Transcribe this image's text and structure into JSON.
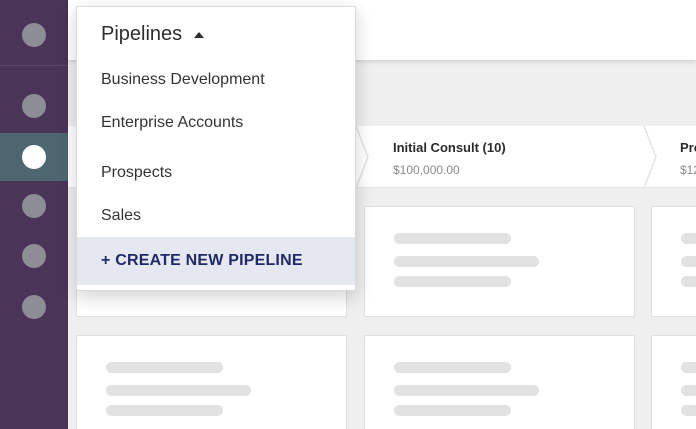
{
  "sidebar": {
    "items": [
      {
        "icon": "nav-dot-icon"
      },
      {
        "icon": "nav-dot-icon"
      },
      {
        "icon": "nav-dot-icon",
        "active": true
      },
      {
        "icon": "nav-dot-icon"
      },
      {
        "icon": "nav-dot-icon"
      },
      {
        "icon": "nav-dot-icon"
      }
    ]
  },
  "pipeline_menu": {
    "title": "Pipelines",
    "items": [
      "Business Development",
      "Enterprise Accounts",
      "Prospects",
      "Sales"
    ],
    "create_label": "+ CREATE NEW PIPELINE"
  },
  "stages": [
    {
      "name": "Initial Consult (10)",
      "amount": "$100,000.00"
    },
    {
      "name": "Pro",
      "amount": "$12"
    }
  ],
  "colors": {
    "sidebar": "#4a3458",
    "active_nav": "#4e6670",
    "create_bg": "#e6e8f1",
    "create_text": "#1f2a66"
  }
}
